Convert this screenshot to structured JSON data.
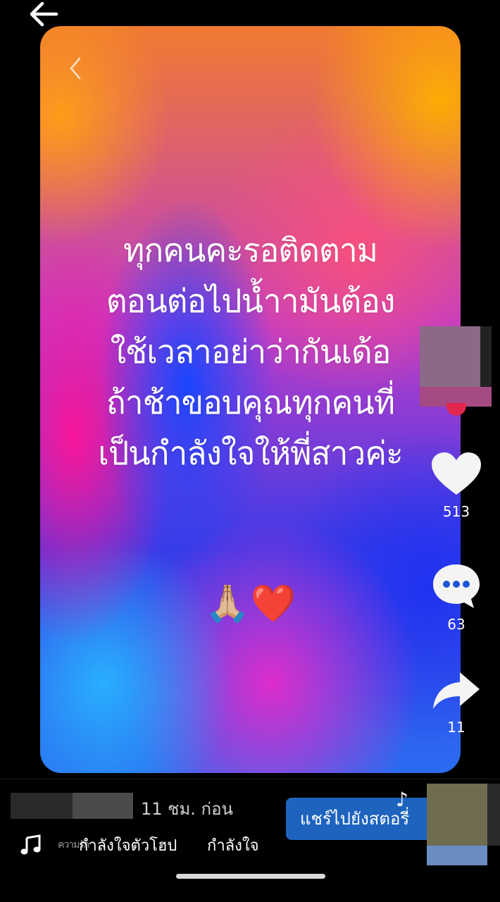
{
  "post": {
    "message_lines": [
      "ทุกคนคะรอติดตาม",
      "ตอนต่อไปน้ำามันต้อง",
      "ใช้เวลาอย่าว่ากันเด้อ",
      "ถ้าช้าขอบคุณทุกคนที่",
      "เป็นกำลังใจให้พี่สาวค่ะ"
    ],
    "emojis": [
      "🙏🏼",
      "❤️"
    ]
  },
  "actions": {
    "like_count": "513",
    "comment_count": "63",
    "share_count": "11"
  },
  "meta": {
    "time_ago": "11 ชม. ก่อน",
    "share_story_label": "แชร์ไปยังสตอรี่"
  },
  "music": {
    "faded_text": "ความรัก",
    "title": "กำลังใจตัวโฮป",
    "tag": "กำลังใจ"
  },
  "colors": {
    "background": "#000000",
    "story_button": "#1e64bf",
    "follow_badge": "#e2264d"
  }
}
